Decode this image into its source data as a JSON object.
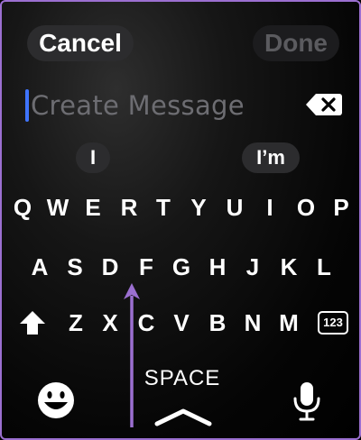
{
  "header": {
    "cancel_label": "Cancel",
    "done_label": "Done"
  },
  "input": {
    "placeholder": "Create Message"
  },
  "suggestions": [
    "I",
    "I’m"
  ],
  "keyboard": {
    "row1": [
      "Q",
      "W",
      "E",
      "R",
      "T",
      "Y",
      "U",
      "I",
      "O",
      "P"
    ],
    "row2": [
      "A",
      "S",
      "D",
      "F",
      "G",
      "H",
      "J",
      "K",
      "L"
    ],
    "row3": [
      "Z",
      "X",
      "C",
      "V",
      "B",
      "N",
      "M"
    ],
    "numbers_label": "123",
    "space_label": "SPACE"
  },
  "icons": {
    "backspace": "backspace-icon",
    "shift": "shift-icon",
    "emoji": "emoji-icon",
    "mic": "microphone-icon",
    "chevron": "chevron-up-icon",
    "annotation_arrow": "arrow-up-icon"
  },
  "colors": {
    "accent_cursor": "#3f74ff",
    "annotation": "#9b6fd0"
  }
}
